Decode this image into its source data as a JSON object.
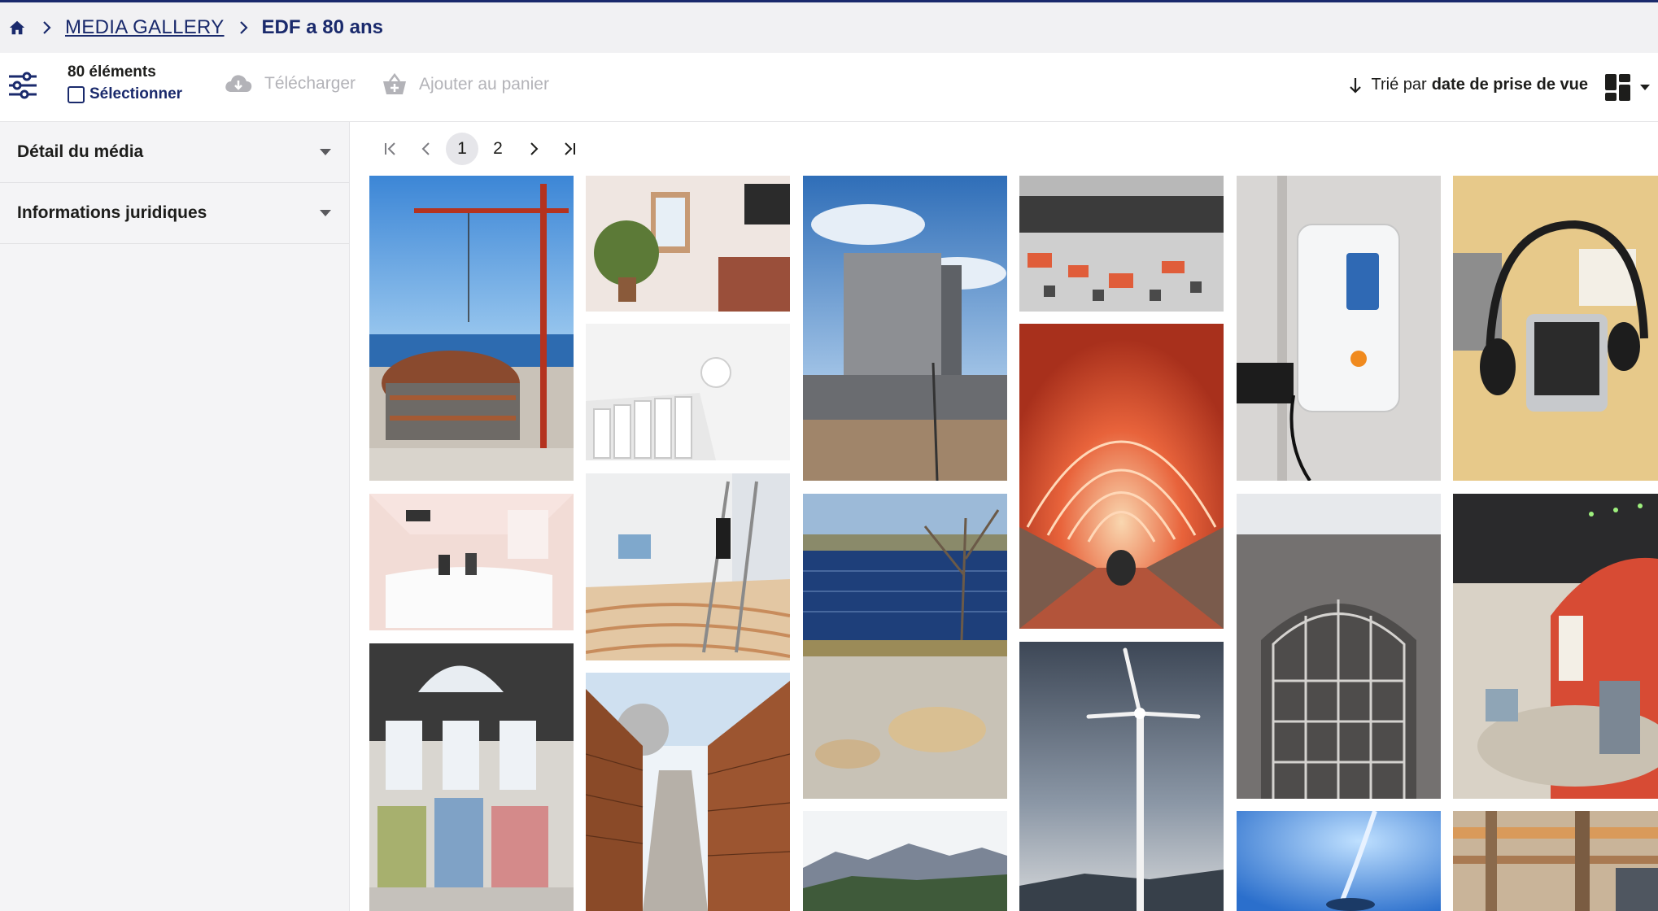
{
  "breadcrumb": {
    "home_icon": "home-icon",
    "gallery_label": "MEDIA GALLERY",
    "current_label": "EDF a 80 ans"
  },
  "toolbar": {
    "count_label": "80 éléments",
    "select_label": "Sélectionner",
    "download_label": "Télécharger",
    "add_to_cart_label": "Ajouter au panier",
    "sort_prefix": "Trié par",
    "sort_value": "date de prise de vue"
  },
  "sidebar": {
    "items": [
      {
        "label": "Détail du média"
      },
      {
        "label": "Informations juridiques"
      }
    ]
  },
  "pagination": {
    "pages": [
      "1",
      "2"
    ],
    "current": "1"
  },
  "colors": {
    "brand_navy": "#1a2a6c",
    "disabled_gray": "#b3b3b8",
    "sidebar_bg": "#f4f4f6"
  },
  "icons": {
    "filter": "sliders-icon",
    "download": "cloud-download-icon",
    "cart": "basket-icon",
    "sort": "arrow-down-icon",
    "view": "grid-view-icon"
  },
  "gallery": {
    "thumbnails": [
      "crane-construction-site",
      "room-with-window",
      "tall-industrial-building",
      "control-room-panels",
      "edf-charging-station",
      "telephone-headset",
      "radiator-with-valve",
      "orange-arched-tunnel",
      "reception-desk-room",
      "worker-on-ladder",
      "solar-panels-field",
      "edf-arched-facade",
      "museum-turbine-hall",
      "turbine-hall-machines",
      "rebar-construction-walls",
      "gravel-closeup",
      "wind-turbine",
      "mountain-landscape",
      "blue-wind-turbine",
      "industrial-pipes"
    ]
  }
}
